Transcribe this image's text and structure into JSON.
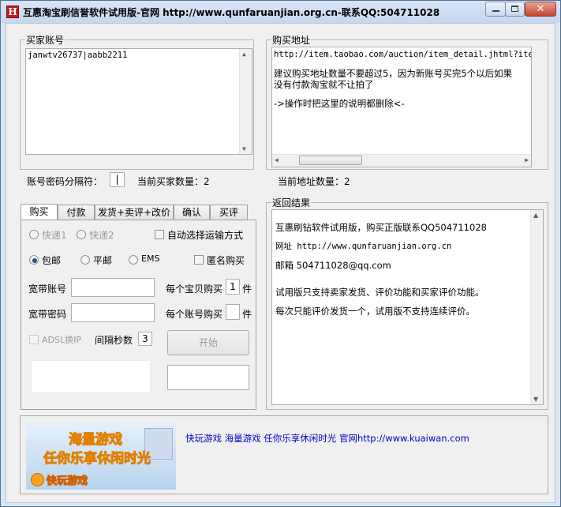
{
  "window": {
    "icon_glyph": "H",
    "title": "互惠淘宝刷信誉软件试用版-官网 http://www.qunfaruanjian.org.cn-联系QQ:504711028",
    "close_glyph": "✕"
  },
  "buyer_accounts": {
    "legend": "买家账号",
    "lines": [
      "janwtv26737|aabb2211"
    ],
    "separator_label": "账号密码分隔符：",
    "separator_value": "|",
    "count_label": "当前买家数量：2"
  },
  "purchase_urls": {
    "legend": "购买地址",
    "lines": [
      "http://item.taobao.com/auction/item_detail.jhtml?item_",
      "",
      "建议购买地址数量不要超过5，因为新账号买完5个以后如果",
      "没有付款淘宝就不让拍了",
      "",
      "->操作时把这里的说明都删除<-"
    ],
    "count_label": "当前地址数量：2"
  },
  "tabs": [
    "购买",
    "付款",
    "发货+卖评+改价",
    "确认",
    "买评"
  ],
  "buy_tab": {
    "express1": "快递1",
    "express2": "快递2",
    "auto_shipping": "自动选择运输方式",
    "free_shipping": "包邮",
    "surface_mail": "平邮",
    "ems": "EMS",
    "anonymous": "匿名购买",
    "broadband_account_label": "宽带账号",
    "broadband_password_label": "宽带密码",
    "per_item_label": "每个宝贝购买",
    "per_item_value": "1",
    "per_item_unit": "件",
    "per_account_label": "每个账号购买",
    "per_account_value": "",
    "per_account_unit": "件",
    "adsl": "ADSL换IP",
    "interval_label": "间隔秒数",
    "interval_value": "3",
    "start_button": "开始"
  },
  "results": {
    "legend": "返回结果",
    "lines": [
      "互惠刷钻软件试用版，购买正版联系QQ504711028",
      "网址 http://www.qunfaruanjian.org.cn",
      "邮箱 504711028@qq.com",
      "试用版只支持卖家发货、评价功能和买家评价功能。",
      "每次只能评价发货一个，试用版不支持连续评价。"
    ]
  },
  "banner": {
    "headline1": "海量游戏",
    "headline2": "任你乐享休闲时光",
    "logo": "快玩游戏",
    "link_text": "快玩游戏 海量游戏 任你乐享休闲时光 官网http://www.kuaiwan.com"
  },
  "colors": {
    "title_bg": "#d1e0f3",
    "close_red": "#c4432f",
    "banner_orange": "#f8a31e",
    "link_blue": "#0000c8"
  }
}
